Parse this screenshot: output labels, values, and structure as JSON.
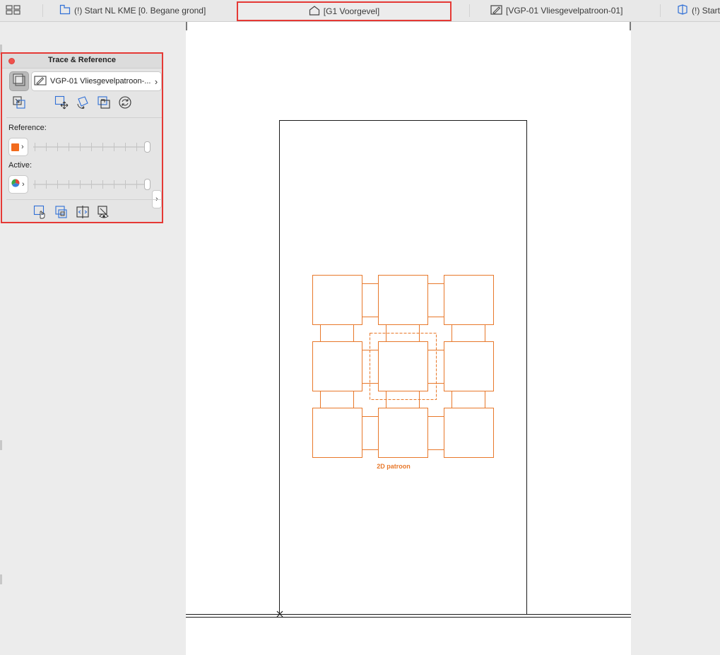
{
  "tabs": [
    {
      "id": "grid",
      "icon": "grid-view-icon",
      "label": ""
    },
    {
      "id": "begane",
      "icon": "floor-plan-icon",
      "label": "(!) Start NL KME [0. Begane grond]"
    },
    {
      "id": "voorgevel",
      "icon": "elevation-house-icon",
      "label": "[G1 Voorgevel]",
      "active": true
    },
    {
      "id": "vgp",
      "icon": "worksheet-pencil-icon",
      "label": "[VGP-01 Vliesgevelpatroon-01]"
    },
    {
      "id": "start2",
      "icon": "3d-view-icon",
      "label": "(!) Start"
    }
  ],
  "trace_panel": {
    "title": "Trace & Reference",
    "reference_source": "VGP-01 Vliesgevelpatroon-...",
    "reference_label": "Reference:",
    "active_label": "Active:",
    "reference_swatch_color": "#f26b1d",
    "reference_slider_position": 1.0,
    "active_slider_position": 1.0,
    "toolbar_icons": [
      "swap-reference-icon",
      "move-reference-icon",
      "rotate-reference-icon",
      "mirror-reference-icon",
      "reset-reference-icon"
    ],
    "bottom_icons": [
      "select-reference-hand-icon",
      "copy-reference-icon",
      "compare-reference-icon",
      "show-hide-reference-icon"
    ]
  },
  "canvas": {
    "pattern_label": "2D patroon",
    "pattern_color": "#e8782a",
    "line_color": "#1a1a1a"
  }
}
